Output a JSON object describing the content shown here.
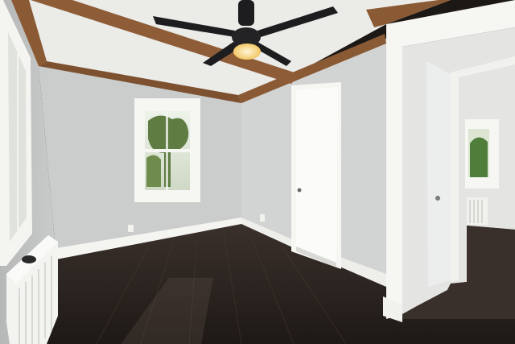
{
  "scene": {
    "kind": "photo",
    "subject": "empty-room-interior",
    "colors": {
      "wall": "#cfd1d0",
      "wall_shadow": "#b9bbba",
      "ceiling": "#ebebe8",
      "beam": "#8a5a35",
      "trim": "#f6f6f3",
      "floor": "#2e2622",
      "floor_highlight": "#5a4d45",
      "fan": "#1d1d1f",
      "light": "#f6d27a",
      "foliage": "#5f7d43"
    }
  }
}
